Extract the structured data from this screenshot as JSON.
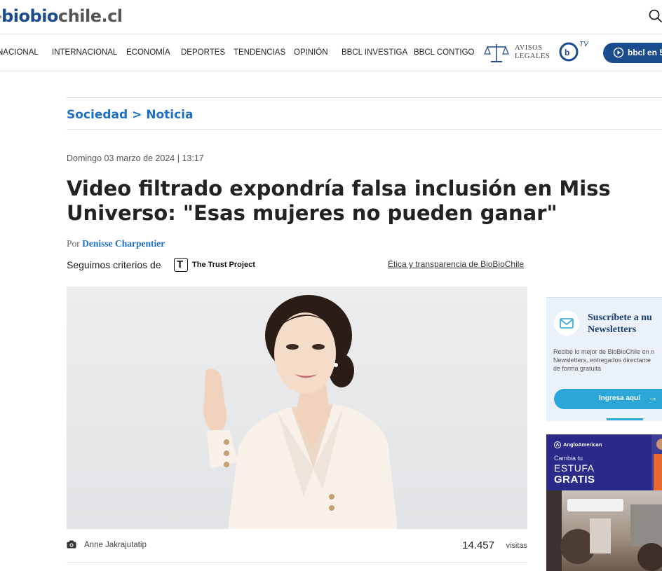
{
  "header": {
    "logo": {
      "prefix": "la",
      "part_a": "biobio",
      "part_b": "chile.cl"
    }
  },
  "nav": {
    "items": [
      "NACIONAL",
      "INTERNACIONAL",
      "ECONOMÍA",
      "DEPORTES",
      "TENDENCIAS",
      "OPINIÓN",
      "BBCL INVESTIGA",
      "BBCL CONTIGO"
    ],
    "avisos_line1": "AVISOS",
    "avisos_line2": "LEGALES",
    "tv_label": "TV",
    "cta_label": "bbcl en 5"
  },
  "article": {
    "breadcrumb": "Sociedad > Noticia",
    "date": "Domingo 03 marzo de 2024 | 13:17",
    "headline": "Video filtrado expondría falsa inclusión en Miss Universo: \"Esas mujeres no pueden ganar\"",
    "byline_prefix": "Por",
    "author": "Denisse Charpentier",
    "trust_label": "Seguimos criterios de",
    "trust_logo_letter": "T",
    "trust_name": "The Trust Project",
    "ethics_link": "Ética y transparencia de BioBioChile",
    "photo_credit": "Anne Jakrajutatip",
    "views": "14.457",
    "views_label": "visitas"
  },
  "sidebar": {
    "newsletter": {
      "title_line1": "Suscríbete a nu",
      "title_line2": "Newsletters",
      "description": "Recibe lo mejor de BioBioChile en n\nNewsletters, entregados directame\nde forma gratuita",
      "button_label": "Ingresa aquí",
      "button_arrow": "→"
    },
    "ad": {
      "brand": "AngloAmerican",
      "line1": "Cambia tu",
      "line2": "ESTUFA",
      "line3": "GRATIS"
    }
  },
  "colors": {
    "brand_blue": "#1a4b8c",
    "link_blue": "#1f6fc1",
    "newsletter_button": "#2aa7d8",
    "ad_purple": "#2c2a88"
  }
}
